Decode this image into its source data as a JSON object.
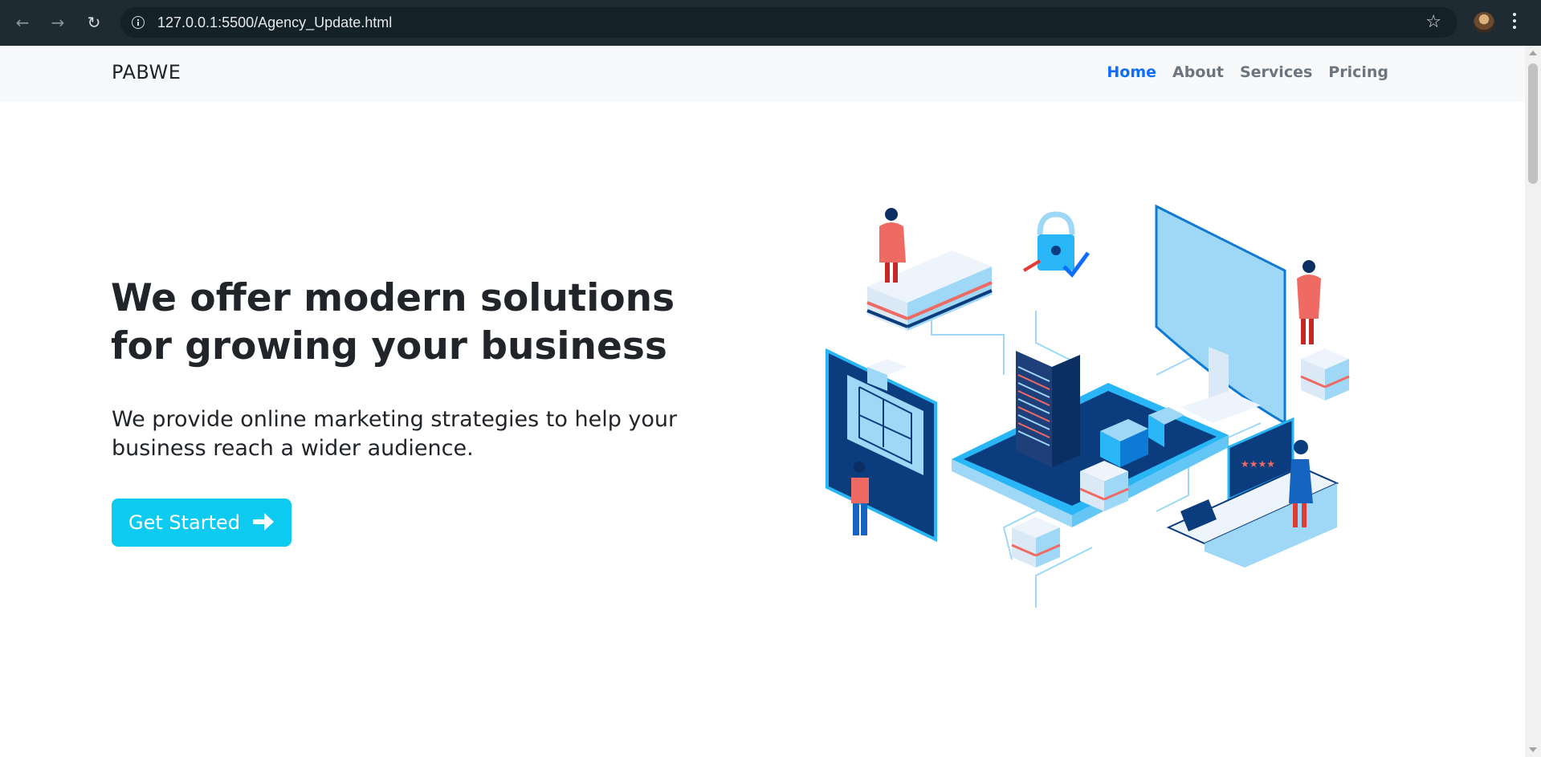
{
  "browser": {
    "url": "127.0.0.1:5500/Agency_Update.html"
  },
  "navbar": {
    "brand": "PABWE",
    "links": [
      "Home",
      "About",
      "Services",
      "Pricing"
    ],
    "active": "Home"
  },
  "hero": {
    "title": "We offer modern solutions for growing your business",
    "subtitle": "We provide online marketing strategies to help your business reach a wider audience.",
    "cta_label": "Get Started"
  },
  "colors": {
    "primary": "#0d6efd",
    "cta": "#0dcaf0",
    "illustration_dark": "#0b3c7d",
    "illustration_light": "#9fd8f7",
    "illustration_accent": "#f06a64"
  },
  "icons": [
    "back-arrow-icon",
    "forward-arrow-icon",
    "reload-icon",
    "info-icon",
    "star-icon",
    "avatar",
    "menu-icon",
    "right-arrow-icon"
  ]
}
